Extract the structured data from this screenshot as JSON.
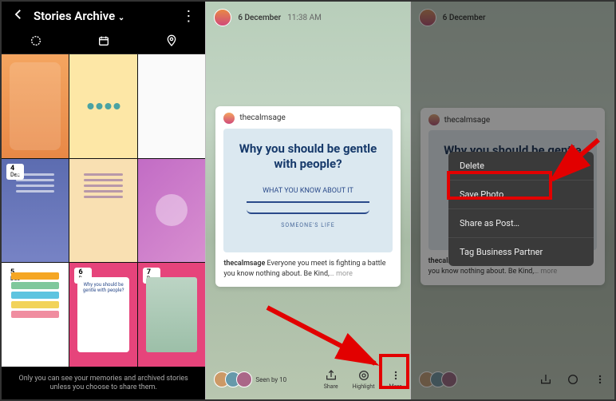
{
  "panel1": {
    "title": "Stories Archive",
    "footer": "Only you can see your memories and archived stories unless you choose to share them.",
    "tiles": [
      {
        "day": "4",
        "month": "Dec"
      },
      {
        "day": "5",
        "month": "Dec"
      },
      {
        "day": "6",
        "month": "Dec"
      },
      {
        "day": "7",
        "month": "Dec"
      }
    ],
    "card8_text": "Why you should be gentle with people?"
  },
  "story": {
    "date": "6 December",
    "time": "11:38 AM",
    "username": "thecalmsage",
    "heading": "Why you should be gentle with people?",
    "arrow_label": "WHAT YOU KNOW ABOUT IT",
    "small_label": "SOMEONE'S LIFE",
    "caption_user": "thecalmsage",
    "caption_text": " Everyone you meet is fighting a battle you know nothing about. Be Kind,",
    "caption_more": "… more",
    "seen_label": "Seen by 10",
    "actions": {
      "share": "Share",
      "highlight": "Highlight",
      "more": "More"
    }
  },
  "menu": {
    "delete": "Delete",
    "save": "Save Photo",
    "share": "Share as Post…",
    "tag": "Tag Business Partner"
  }
}
